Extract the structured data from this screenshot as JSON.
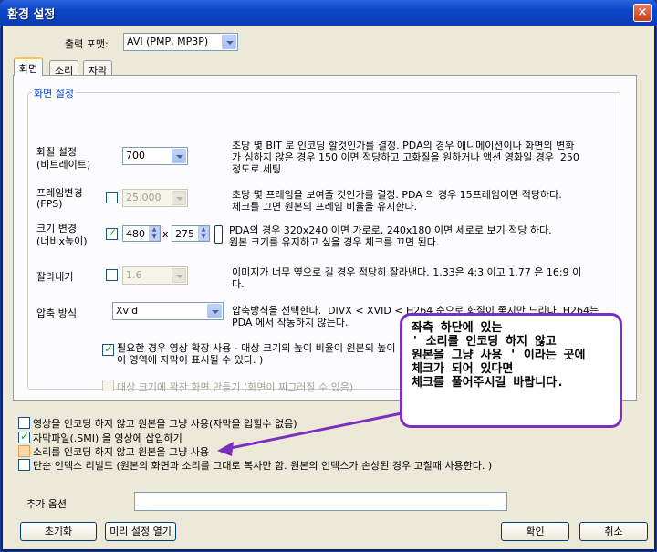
{
  "window": {
    "title": "환경 설정",
    "close": "×"
  },
  "output_format": {
    "label": "출력 포맷:",
    "value": "AVI (PMP, MP3P)"
  },
  "tabs": [
    {
      "label": "화면"
    },
    {
      "label": "소리"
    },
    {
      "label": "자막"
    }
  ],
  "screen_group": {
    "title": "화면 설정",
    "quality": {
      "label1": "화질 설정",
      "label2": "(비트레이트)",
      "value": "700",
      "desc": "초당 몇 BIT 로 인코딩 할것인가를 결정. PDA의 경우 애니메이션이나 화면의 변화\n가 심하지 않은 경우 150 이면 적당하고 고화질을 원하거나 액션 영화일 경우  250\n정도로 세팅"
    },
    "fps": {
      "label1": "프레임변경",
      "label2": "(FPS)",
      "value": "25.000",
      "desc": "초당 몇 프레임을 보여줄 것인가를 결정. PDA 의 경우 15프레임이면 적당하다.\n체크를 끄면 원본의 프레임 비율을 유지한다."
    },
    "resize": {
      "label1": "크기 변경",
      "label2": "(너비x높이)",
      "width": "480",
      "x": "x",
      "height": "275",
      "desc": "PDA의 경우 320x240 이면 가로로, 240x180 이면 세로로 보기 적당 하다.\n원본 크기를 유지하고 싶을 경우 체크를 끄면 된다."
    },
    "crop": {
      "label": "잘라내기",
      "value": "1.6",
      "desc": "이미지가 너무 옆으로 길 경우 적당히 잘라낸다. 1.33은 4:3 이고 1.77 은 16:9 이\n다."
    },
    "codec": {
      "label": "압축 방식",
      "value": "Xvid",
      "desc": "압축방식을 선택한다.  DIVX < XVID < H264 순으로 화질이 좋지만 느리다. H264는\nPDA 에서 작동하지 않는다."
    },
    "expand": {
      "label": "필요한 경우 영상 확장 사용 - 대상 크기의 높이 비율이 원본의 높이 비율보다 클 경우 아래에 검은  영역 추가 (\n이 영역에 자막이 표시될 수 있다. )"
    },
    "fit": {
      "label": "대상 크기에 꽉찬 화면 만들기 (화면이 찌그러질 수 있음)"
    }
  },
  "options": [
    {
      "label": "영상을 인코딩 하지 않고 원본을 그냥 사용(자막을 입힐수 없음)",
      "checked": false
    },
    {
      "label": "자막파일(.SMI) 을 영상에 삽입하기",
      "checked": true
    },
    {
      "label": "소리를 인코딩 하지 않고 원본을 그냥 사용",
      "checked": false
    },
    {
      "label": "단순 인덱스 리빌드 (원본의 화면과 소리를 그대로 복사만 함. 원본의 인덱스가 손상된 경우 고칠때 사용한다. )",
      "checked": false
    }
  ],
  "extra_options": {
    "label": "추가 옵션",
    "value": ""
  },
  "buttons": {
    "reset": "초기화",
    "presets": "미리 설정 열기",
    "ok": "확인",
    "cancel": "취소"
  },
  "annotation": {
    "lines": [
      "좌측 하단에 있는",
      "' 소리를 인코딩 하지 않고",
      "원본을 그냥 사용 ' 이라는 곳에",
      "체크가 되어 있다면",
      "체크를 풀어주시길 바랍니다."
    ],
    "color": "#7b2fbe"
  }
}
